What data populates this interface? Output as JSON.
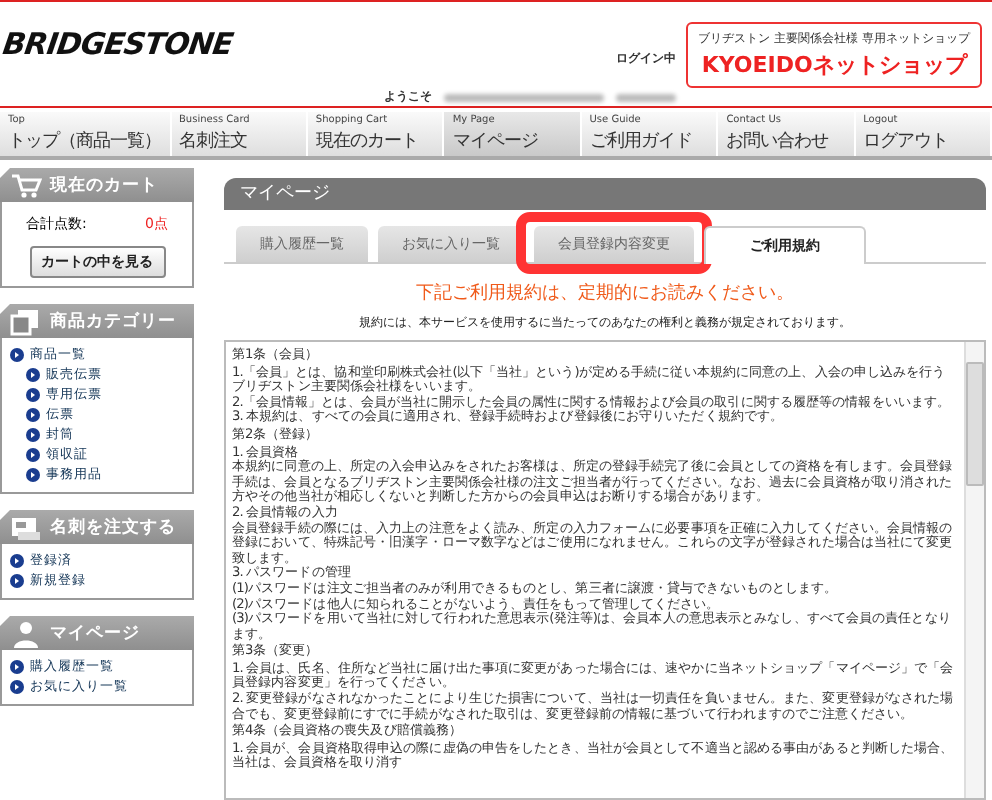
{
  "header": {
    "logo": "BRIDGESTONE",
    "login_status": "ログイン中",
    "welcome": "ようこそ",
    "shop_tagline": "ブリヂストン 主要関係会社様 専用ネットショップ",
    "shop_name": "KYOEIDOネットショップ"
  },
  "nav": [
    {
      "en": "Top",
      "label": "トップ（商品一覧）",
      "selected": false
    },
    {
      "en": "Business Card",
      "label": "名刺注文",
      "selected": false
    },
    {
      "en": "Shopping Cart",
      "label": "現在のカート",
      "selected": false
    },
    {
      "en": "My Page",
      "label": "マイページ",
      "selected": true
    },
    {
      "en": "Use Guide",
      "label": "ご利用ガイド",
      "selected": false
    },
    {
      "en": "Contact Us",
      "label": "お問い合わせ",
      "selected": false
    },
    {
      "en": "Logout",
      "label": "ログアウト",
      "selected": false
    }
  ],
  "sidebar": [
    {
      "kind": "cart",
      "title": "現在のカート",
      "total_label": "合計点数:",
      "total_value": "0点",
      "button": "カートの中を見る"
    },
    {
      "kind": "category",
      "title": "商品カテゴリー",
      "items": [
        {
          "label": "商品一覧",
          "children": [
            {
              "label": "販売伝票"
            },
            {
              "label": "専用伝票"
            },
            {
              "label": "伝票"
            },
            {
              "label": "封筒"
            },
            {
              "label": "領収証"
            },
            {
              "label": "事務用品"
            }
          ]
        }
      ]
    },
    {
      "kind": "card",
      "title": "名刺を注文する",
      "items": [
        {
          "label": "登録済"
        },
        {
          "label": "新規登録"
        }
      ]
    },
    {
      "kind": "mypage",
      "title": "マイページ",
      "items": [
        {
          "label": "購入履歴一覧"
        },
        {
          "label": "お気に入り一覧"
        }
      ]
    }
  ],
  "main": {
    "heading": "マイページ",
    "tabs": [
      {
        "label": "購入履歴一覧",
        "selected": false,
        "annotated": false
      },
      {
        "label": "お気に入り一覧",
        "selected": false,
        "annotated": false
      },
      {
        "label": "会員登録内容変更",
        "selected": false,
        "annotated": true
      },
      {
        "label": "ご利用規約",
        "selected": true,
        "annotated": false
      }
    ],
    "notice": "下記ご利用規約は、定期的にお読みください。",
    "intro": "規約には、本サービスを使用するに当たってのあなたの権利と義務が規定されております。",
    "terms": [
      {
        "kind": "heading",
        "text": "第1条（会員）"
      },
      {
        "kind": "para",
        "text": "1.「会員」とは、協和堂印刷株式会社(以下「当社」という)が定める手続に従い本規約に同意の上、入会の申し込みを行うブリヂストン主要関係会社様をいいます。"
      },
      {
        "kind": "para",
        "text": "2.「会員情報」とは、会員が当社に開示した会員の属性に関する情報および会員の取引に関する履歴等の情報をいいます。"
      },
      {
        "kind": "para",
        "text": "3. 本規約は、すべての会員に適用され、登録手続時および登録後にお守りいただく規約です。"
      },
      {
        "kind": "heading",
        "text": "第2条（登録）"
      },
      {
        "kind": "para",
        "text": "1. 会員資格"
      },
      {
        "kind": "para",
        "text": "本規約に同意の上、所定の入会申込みをされたお客様は、所定の登録手続完了後に会員としての資格を有します。会員登録手続は、会員となるブリヂストン主要関係会社様の注文ご担当者が行ってください。なお、過去に会員資格が取り消された方やその他当社が相応しくないと判断した方からの会員申込はお断りする場合があります。"
      },
      {
        "kind": "para",
        "text": "2. 会員情報の入力"
      },
      {
        "kind": "para",
        "text": "会員登録手続の際には、入力上の注意をよく読み、所定の入力フォームに必要事項を正確に入力してください。会員情報の登録において、特殊記号・旧漢字・ローマ数字などはご使用になれません。これらの文字が登録された場合は当社にて変更致します。"
      },
      {
        "kind": "para",
        "text": "3. パスワードの管理"
      },
      {
        "kind": "para",
        "text": "(1)パスワードは注文ご担当者のみが利用できるものとし、第三者に譲渡・貸与できないものとします。"
      },
      {
        "kind": "para",
        "text": "(2)パスワードは他人に知られることがないよう、責任をもって管理してください。"
      },
      {
        "kind": "para",
        "text": "(3)パスワードを用いて当社に対して行われた意思表示(発注等)は、会員本人の意思表示とみなし、すべて会員の責任となります。"
      },
      {
        "kind": "heading",
        "text": "第3条（変更）"
      },
      {
        "kind": "para",
        "text": "1. 会員は、氏名、住所など当社に届け出た事項に変更があった場合には、速やかに当ネットショップ「マイページ」で「会員登録内容変更」を行ってください。"
      },
      {
        "kind": "para",
        "text": "2. 変更登録がなされなかったことにより生じた損害について、当社は一切責任を負いません。また、変更登録がなされた場合でも、変更登録前にすでに手続がなされた取引は、変更登録前の情報に基づいて行われますのでご注意ください。"
      },
      {
        "kind": "heading",
        "text": "第4条（会員資格の喪失及び賠償義務）"
      },
      {
        "kind": "para",
        "text": "1. 会員が、会員資格取得申込の際に虚偽の申告をしたとき、当社が会員として不適当と認める事由があると判断した場合、当社は、会員資格を取り消す"
      }
    ]
  }
}
